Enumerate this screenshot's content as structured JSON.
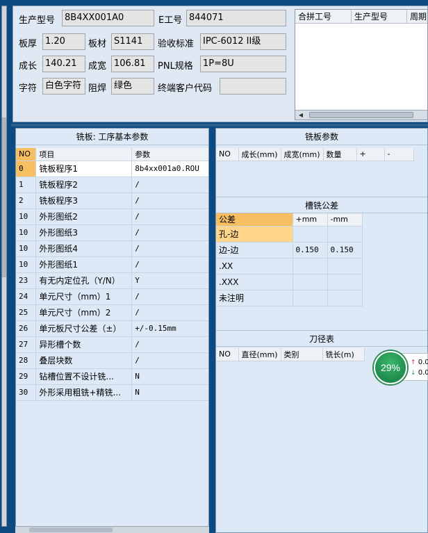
{
  "top": {
    "fields": [
      {
        "label": "生产型号",
        "value": "8B4XX001A0"
      },
      {
        "label": "E工号",
        "value": "844071"
      },
      {
        "label": "板厚",
        "value": "1.20"
      },
      {
        "label": "板材",
        "value": "S1141"
      },
      {
        "label": "验收标准",
        "value": "IPC-6012 II级"
      },
      {
        "label": "成长",
        "value": "140.21"
      },
      {
        "label": "成宽",
        "value": "106.81"
      },
      {
        "label": "PNL规格",
        "value": "1P=8U"
      },
      {
        "label": "字符",
        "value": "白色字符"
      },
      {
        "label": "阻焊",
        "value": "绿色"
      },
      {
        "label": "终端客户代码",
        "value": ""
      }
    ],
    "grid_headers": [
      "合拼工号",
      "生产型号",
      "周期"
    ]
  },
  "left": {
    "title": "铣板: 工序基本参数",
    "headers": [
      "NO",
      "项目",
      "参数"
    ],
    "rows": [
      {
        "no": "0",
        "item": "铣板程序1",
        "param": "8b4xx001a0.ROU"
      },
      {
        "no": "1",
        "item": "铣板程序2",
        "param": "/"
      },
      {
        "no": "2",
        "item": "铣板程序3",
        "param": "/"
      },
      {
        "no": "10",
        "item": "外形图纸2",
        "param": "/"
      },
      {
        "no": "10",
        "item": "外形图纸3",
        "param": "/"
      },
      {
        "no": "10",
        "item": "外形图纸4",
        "param": "/"
      },
      {
        "no": "10",
        "item": "外形图纸1",
        "param": "/"
      },
      {
        "no": "23",
        "item": "有无内定位孔（Y/N）",
        "param": "Y"
      },
      {
        "no": "24",
        "item": "单元尺寸（mm）1",
        "param": "/"
      },
      {
        "no": "25",
        "item": "单元尺寸（mm）2",
        "param": "/"
      },
      {
        "no": "26",
        "item": "单元板尺寸公差（±）",
        "param": "+/-0.15mm"
      },
      {
        "no": "27",
        "item": "异形槽个数",
        "param": "/"
      },
      {
        "no": "28",
        "item": "叠层块数",
        "param": "/"
      },
      {
        "no": "29",
        "item": "钻槽位置不设计铣...",
        "param": "N"
      },
      {
        "no": "30",
        "item": "外形采用粗铣+精铣...",
        "param": "N"
      }
    ]
  },
  "right": {
    "mill_title": "铣板参数",
    "mill_headers": [
      "NO",
      "成长(mm)",
      "成宽(mm)",
      "数量",
      "+",
      "-"
    ],
    "tol_title": "槽铣公差",
    "tol_headers": [
      "公差",
      "+mm",
      "-mm"
    ],
    "tol_rows": [
      {
        "name": "孔-边",
        "plus": "",
        "minus": ""
      },
      {
        "name": "边-边",
        "plus": "0.150",
        "minus": "0.150"
      },
      {
        "name": ".XX",
        "plus": "",
        "minus": ""
      },
      {
        "name": ".XXX",
        "plus": "",
        "minus": ""
      },
      {
        "name": "未注明",
        "plus": "",
        "minus": ""
      }
    ],
    "tool_title": "刀径表",
    "tool_headers": [
      "NO",
      "直径(mm)",
      "类别",
      "铣长(m)"
    ]
  },
  "badge": {
    "percent": "29%",
    "up": "0.0",
    "down": "0.0",
    "up_color": "#d0312d",
    "down_color": "#1f9e4a"
  }
}
